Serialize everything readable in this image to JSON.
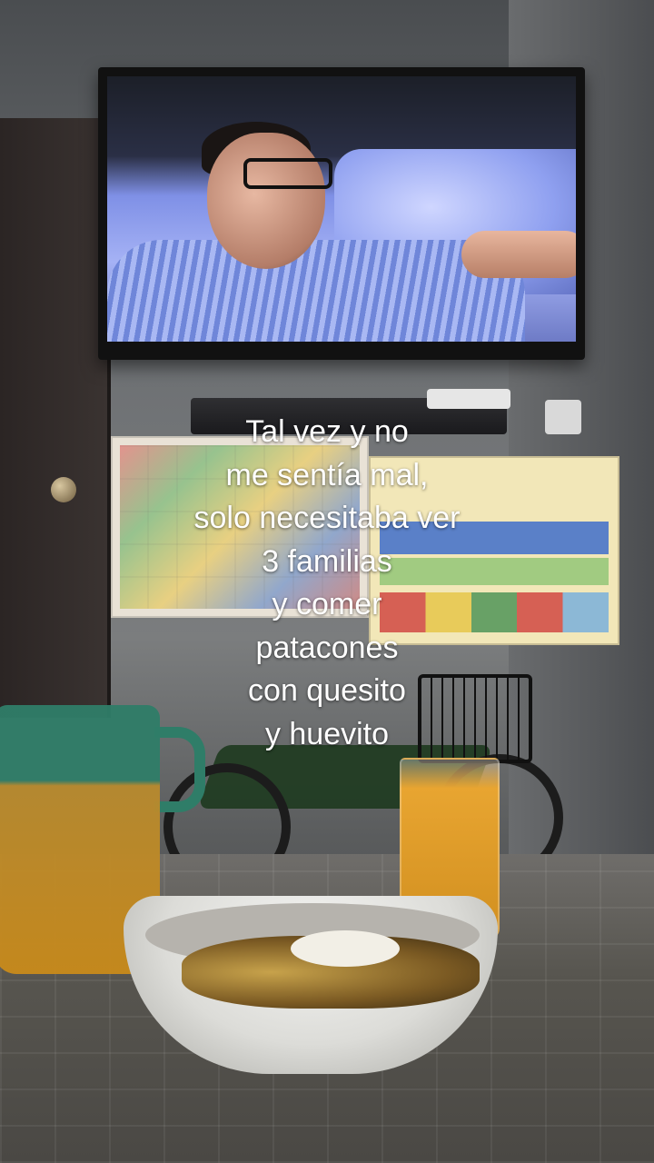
{
  "caption": {
    "lines": [
      "Tal vez y no",
      "me sentía mal,",
      "solo necesitaba ver",
      "3 familias",
      "y comer",
      "patacones",
      "con quesito",
      "y huevito"
    ]
  }
}
